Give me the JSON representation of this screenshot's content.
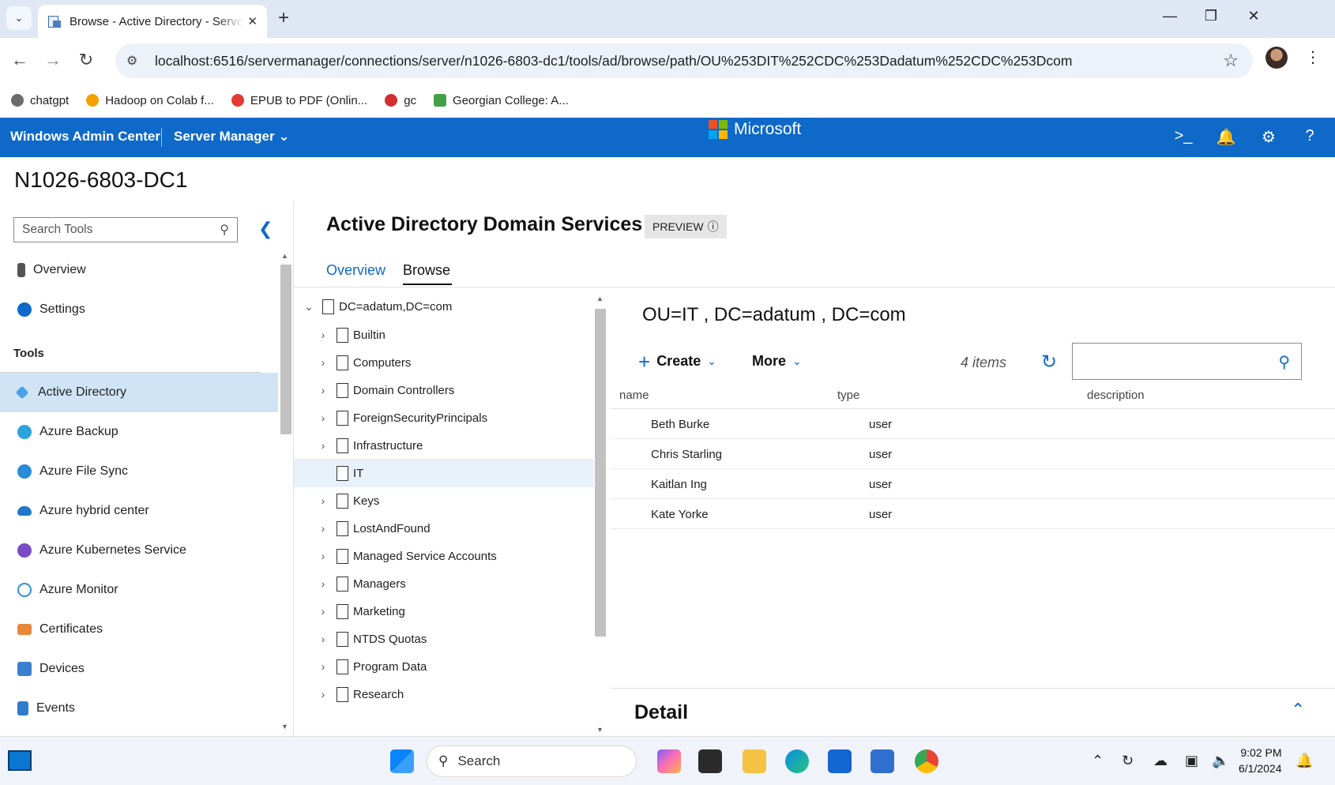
{
  "browser": {
    "tab_title": "Browse - Active Directory - Server Manager",
    "new_tab": "+",
    "url": "localhost:6516/servermanager/connections/server/n1026-6803-dc1/tools/ad/browse/path/OU%253DIT%252CDC%253Dadatum%252CDC%253Dcom",
    "bookmarks": [
      {
        "label": "chatgpt",
        "color": "#6b6b6b"
      },
      {
        "label": "Hadoop on Colab f...",
        "color": "#f4a100"
      },
      {
        "label": "EPUB to PDF (Onlin...",
        "color": "#e53935"
      },
      {
        "label": "gc",
        "color": "#d32f2f"
      },
      {
        "label": "Georgian College: A...",
        "color": "#43a047"
      }
    ]
  },
  "header": {
    "brand": "Windows Admin Center",
    "server_manager": "Server Manager",
    "microsoft": "Microsoft"
  },
  "server_name": "N1026-6803-DC1",
  "sidebar": {
    "search_placeholder": "Search Tools",
    "top_items": [
      {
        "label": "Overview",
        "icon_color": "#555"
      },
      {
        "label": "Settings",
        "icon_color": "#0e69c9"
      }
    ],
    "tools_label": "Tools",
    "tools": [
      {
        "label": "Active Directory",
        "icon_color": "#4aa3e8",
        "selected": true
      },
      {
        "label": "Azure Backup",
        "icon_color": "#29a3d9"
      },
      {
        "label": "Azure File Sync",
        "icon_color": "#2a8bd6"
      },
      {
        "label": "Azure hybrid center",
        "icon_color": "#1f78c8"
      },
      {
        "label": "Azure Kubernetes Service",
        "icon_color": "#7a4bc4"
      },
      {
        "label": "Azure Monitor",
        "icon_color": "#2f8fd8"
      },
      {
        "label": "Certificates",
        "icon_color": "#e8883a"
      },
      {
        "label": "Devices",
        "icon_color": "#3a7fd0"
      },
      {
        "label": "Events",
        "icon_color": "#2f7bd0"
      }
    ]
  },
  "main": {
    "title": "Active Directory Domain Services",
    "preview_badge": "PREVIEW",
    "tabs": [
      {
        "label": "Overview",
        "active": false
      },
      {
        "label": "Browse",
        "active": true
      }
    ],
    "tree_root": "DC=adatum,DC=com",
    "tree": [
      {
        "label": "Builtin",
        "expandable": true
      },
      {
        "label": "Computers",
        "expandable": true
      },
      {
        "label": "Domain Controllers",
        "expandable": true
      },
      {
        "label": "ForeignSecurityPrincipals",
        "expandable": true
      },
      {
        "label": "Infrastructure",
        "expandable": true
      },
      {
        "label": "IT",
        "expandable": false,
        "selected": true
      },
      {
        "label": "Keys",
        "expandable": true
      },
      {
        "label": "LostAndFound",
        "expandable": true
      },
      {
        "label": "Managed Service Accounts",
        "expandable": true
      },
      {
        "label": "Managers",
        "expandable": true
      },
      {
        "label": "Marketing",
        "expandable": true
      },
      {
        "label": "NTDS Quotas",
        "expandable": true
      },
      {
        "label": "Program Data",
        "expandable": true
      },
      {
        "label": "Research",
        "expandable": true
      }
    ],
    "breadcrumb": "OU=IT , DC=adatum , DC=com",
    "create_label": "Create",
    "more_label": "More",
    "items_count": "4 items",
    "columns": [
      "name",
      "type",
      "description"
    ],
    "rows": [
      {
        "name": "Beth Burke",
        "type": "user",
        "description": ""
      },
      {
        "name": "Chris Starling",
        "type": "user",
        "description": ""
      },
      {
        "name": "Kaitlan Ing",
        "type": "user",
        "description": ""
      },
      {
        "name": "Kate Yorke",
        "type": "user",
        "description": ""
      }
    ],
    "detail_label": "Detail"
  },
  "taskbar": {
    "search_label": "Search",
    "time": "9:02 PM",
    "date": "6/1/2024"
  }
}
